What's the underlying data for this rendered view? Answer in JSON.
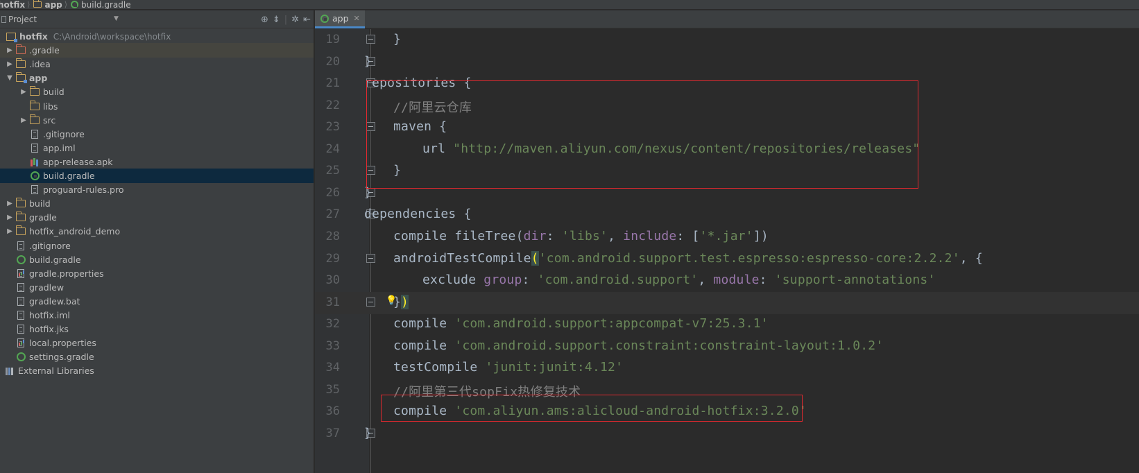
{
  "breadcrumb": [
    {
      "text": "hotfix",
      "icon": "project-folder-icon"
    },
    {
      "text": "app",
      "icon": "module-folder-icon"
    },
    {
      "text": "build.gradle",
      "icon": "gradle-file-icon"
    }
  ],
  "project_panel": {
    "title": "Project",
    "tree": [
      {
        "label": "hotfix",
        "hint": "C:\\Android\\workspace\\hotfix",
        "icon": "root",
        "depth": 0,
        "arrow": "",
        "bold": true
      },
      {
        "label": ".gradle",
        "icon": "folder-red",
        "depth": 0,
        "arrow": "▶",
        "hover": true
      },
      {
        "label": ".idea",
        "icon": "folder",
        "depth": 0,
        "arrow": "▶"
      },
      {
        "label": "app",
        "icon": "folder-mod",
        "depth": 0,
        "arrow": "▼",
        "bold": true
      },
      {
        "label": "build",
        "icon": "folder",
        "depth": 1,
        "arrow": "▶"
      },
      {
        "label": "libs",
        "icon": "folder",
        "depth": 1,
        "arrow": ""
      },
      {
        "label": "src",
        "icon": "folder",
        "depth": 1,
        "arrow": "▶"
      },
      {
        "label": ".gitignore",
        "icon": "file",
        "depth": 1,
        "arrow": ""
      },
      {
        "label": "app.iml",
        "icon": "file",
        "depth": 1,
        "arrow": ""
      },
      {
        "label": "app-release.apk",
        "icon": "apk",
        "depth": 1,
        "arrow": ""
      },
      {
        "label": "build.gradle",
        "icon": "gradle",
        "depth": 1,
        "arrow": "",
        "selected": true
      },
      {
        "label": "proguard-rules.pro",
        "icon": "file",
        "depth": 1,
        "arrow": ""
      },
      {
        "label": "build",
        "icon": "folder",
        "depth": 0,
        "arrow": "▶"
      },
      {
        "label": "gradle",
        "icon": "folder",
        "depth": 0,
        "arrow": "▶"
      },
      {
        "label": "hotfix_android_demo",
        "icon": "folder",
        "depth": 0,
        "arrow": "▶"
      },
      {
        "label": ".gitignore",
        "icon": "file",
        "depth": 0,
        "arrow": ""
      },
      {
        "label": "build.gradle",
        "icon": "gradle",
        "depth": 0,
        "arrow": ""
      },
      {
        "label": "gradle.properties",
        "icon": "props",
        "depth": 0,
        "arrow": ""
      },
      {
        "label": "gradlew",
        "icon": "file",
        "depth": 0,
        "arrow": ""
      },
      {
        "label": "gradlew.bat",
        "icon": "file",
        "depth": 0,
        "arrow": ""
      },
      {
        "label": "hotfix.iml",
        "icon": "file",
        "depth": 0,
        "arrow": ""
      },
      {
        "label": "hotfix.jks",
        "icon": "file",
        "depth": 0,
        "arrow": ""
      },
      {
        "label": "local.properties",
        "icon": "props",
        "depth": 0,
        "arrow": ""
      },
      {
        "label": "settings.gradle",
        "icon": "gradle",
        "depth": 0,
        "arrow": ""
      },
      {
        "label": "External Libraries",
        "icon": "lib",
        "depth": -1,
        "arrow": ""
      }
    ]
  },
  "editor": {
    "tab_label": "app",
    "lines": [
      {
        "n": "19",
        "indent": 1,
        "fold": true,
        "parts": [
          [
            "}",
            "kw"
          ]
        ]
      },
      {
        "n": "20",
        "indent": 0,
        "fold": true,
        "parts": [
          [
            "}",
            "kw"
          ]
        ]
      },
      {
        "n": "21",
        "indent": 0,
        "fold": true,
        "parts": [
          [
            "repositories {",
            "kw"
          ]
        ]
      },
      {
        "n": "22",
        "indent": 1,
        "parts": [
          [
            "//阿里云仓库",
            "cmt"
          ]
        ]
      },
      {
        "n": "23",
        "indent": 1,
        "fold": true,
        "parts": [
          [
            "maven {",
            "kw"
          ]
        ]
      },
      {
        "n": "24",
        "indent": 2,
        "parts": [
          [
            "url ",
            "kw"
          ],
          [
            "\"http://maven.aliyun.com/nexus/content/repositories/releases\"",
            "str"
          ]
        ]
      },
      {
        "n": "25",
        "indent": 1,
        "fold": true,
        "parts": [
          [
            "}",
            "kw"
          ]
        ]
      },
      {
        "n": "26",
        "indent": 0,
        "fold": true,
        "parts": [
          [
            "}",
            "kw"
          ]
        ]
      },
      {
        "n": "27",
        "indent": 0,
        "fold": true,
        "parts": [
          [
            "dependencies {",
            "kw"
          ]
        ]
      },
      {
        "n": "28",
        "indent": 1,
        "parts": [
          [
            "compile fileTree(",
            "kw"
          ],
          [
            "dir",
            "param"
          ],
          [
            ": ",
            "kw"
          ],
          [
            "'libs'",
            "str"
          ],
          [
            ", ",
            "kw"
          ],
          [
            "include",
            "param"
          ],
          [
            ": [",
            "kw"
          ],
          [
            "'*.jar'",
            "str"
          ],
          [
            "])",
            "kw"
          ]
        ]
      },
      {
        "n": "29",
        "indent": 1,
        "fold": true,
        "parts": [
          [
            "androidTestCompile",
            "kw"
          ],
          [
            "(",
            "matchp"
          ],
          [
            "'com.android.support.test.espresso:espresso-core:2.2.2'",
            "str"
          ],
          [
            ", {",
            "kw"
          ]
        ]
      },
      {
        "n": "30",
        "indent": 2,
        "parts": [
          [
            "exclude ",
            "kw"
          ],
          [
            "group",
            "param"
          ],
          [
            ": ",
            "kw"
          ],
          [
            "'com.android.support'",
            "str"
          ],
          [
            ", ",
            "kw"
          ],
          [
            "module",
            "param"
          ],
          [
            ": ",
            "kw"
          ],
          [
            "'support-annotations'",
            "str"
          ]
        ]
      },
      {
        "n": "31",
        "indent": 1,
        "fold": true,
        "bulb": true,
        "caret": true,
        "parts": [
          [
            "}",
            "kw"
          ],
          [
            ")",
            "matchp"
          ]
        ]
      },
      {
        "n": "32",
        "indent": 1,
        "parts": [
          [
            "compile ",
            "kw"
          ],
          [
            "'com.android.support:appcompat-v7:25.3.1'",
            "str"
          ]
        ]
      },
      {
        "n": "33",
        "indent": 1,
        "parts": [
          [
            "compile ",
            "kw"
          ],
          [
            "'com.android.support.constraint:constraint-layout:1.0.2'",
            "str"
          ]
        ]
      },
      {
        "n": "34",
        "indent": 1,
        "parts": [
          [
            "testCompile ",
            "kw"
          ],
          [
            "'junit:junit:4.12'",
            "str"
          ]
        ]
      },
      {
        "n": "35",
        "indent": 1,
        "parts": [
          [
            "//阿里第三代sopFix热修复技术",
            "cmt"
          ]
        ]
      },
      {
        "n": "36",
        "indent": 1,
        "parts": [
          [
            "compile ",
            "kw"
          ],
          [
            "'com.aliyun.ams:alicloud-android-hotfix:3.2.0'",
            "str"
          ]
        ]
      },
      {
        "n": "37",
        "indent": 0,
        "fold": true,
        "parts": [
          [
            "}",
            "kw"
          ]
        ]
      }
    ]
  },
  "colors": {
    "string": "#6a8759",
    "comment": "#808080",
    "param": "#9876aa",
    "annotation_box": "#e0292f",
    "selection": "#0d293e"
  }
}
